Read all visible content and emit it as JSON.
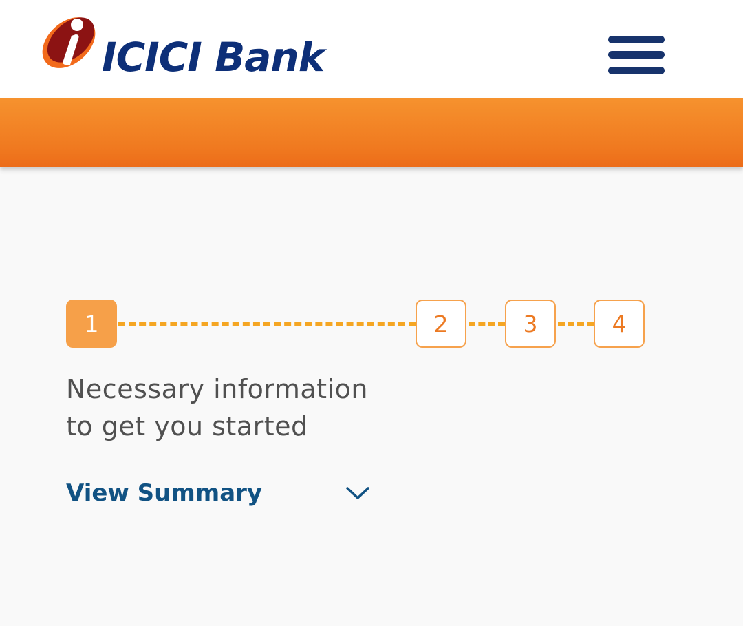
{
  "header": {
    "logo_text": "ICICI Bank",
    "logo_icon": "icici-i-mark",
    "menu_icon": "hamburger-menu-icon"
  },
  "colors": {
    "brand_orange": "#f07a20",
    "brand_navy": "#0d2f78",
    "step_accent": "#f6a049",
    "link_blue": "#115283"
  },
  "stepper": {
    "steps": [
      {
        "label": "1",
        "state": "active"
      },
      {
        "label": "2",
        "state": "pending"
      },
      {
        "label": "3",
        "state": "pending"
      },
      {
        "label": "4",
        "state": "pending"
      }
    ]
  },
  "main": {
    "info_line1": "Necessary information",
    "info_line2": "to get you started",
    "summary_label": "View Summary",
    "summary_icon": "chevron-down-icon"
  }
}
